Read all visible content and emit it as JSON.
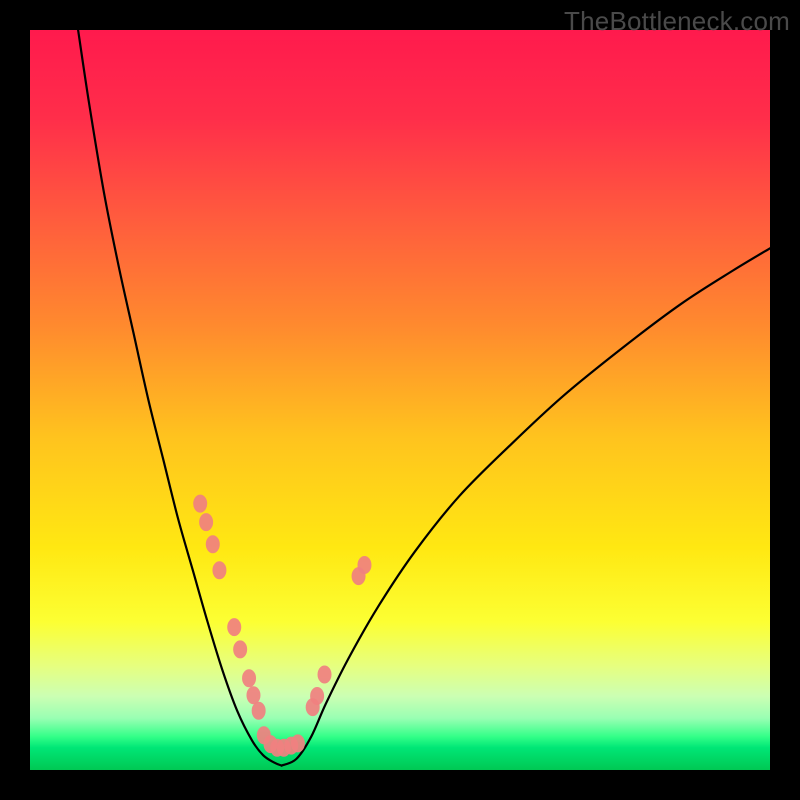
{
  "watermark": "TheBottleneck.com",
  "chart_data": {
    "type": "line",
    "title": "",
    "xlabel": "",
    "ylabel": "",
    "xlim": [
      0,
      100
    ],
    "ylim": [
      0,
      100
    ],
    "background_gradient": {
      "stops": [
        {
          "offset": 0,
          "color": "#ff1a4d"
        },
        {
          "offset": 0.12,
          "color": "#ff2e4a"
        },
        {
          "offset": 0.25,
          "color": "#ff5a3e"
        },
        {
          "offset": 0.4,
          "color": "#ff8a2e"
        },
        {
          "offset": 0.55,
          "color": "#ffc31e"
        },
        {
          "offset": 0.7,
          "color": "#ffe812"
        },
        {
          "offset": 0.8,
          "color": "#fcff33"
        },
        {
          "offset": 0.86,
          "color": "#e6ff80"
        },
        {
          "offset": 0.9,
          "color": "#ccffb3"
        },
        {
          "offset": 0.93,
          "color": "#99ffb3"
        },
        {
          "offset": 0.955,
          "color": "#33ff88"
        },
        {
          "offset": 0.97,
          "color": "#00e676"
        },
        {
          "offset": 1.0,
          "color": "#00c853"
        }
      ]
    },
    "series": [
      {
        "name": "left-curve",
        "stroke": "#000000",
        "values_xy": [
          [
            6.5,
            100.0
          ],
          [
            8.0,
            90.0
          ],
          [
            10.0,
            78.0
          ],
          [
            12.0,
            68.0
          ],
          [
            14.0,
            59.0
          ],
          [
            16.0,
            50.0
          ],
          [
            18.0,
            42.0
          ],
          [
            20.0,
            34.0
          ],
          [
            22.0,
            27.0
          ],
          [
            24.0,
            20.0
          ],
          [
            26.0,
            13.5
          ],
          [
            28.0,
            8.0
          ],
          [
            30.0,
            4.0
          ],
          [
            31.5,
            2.0
          ],
          [
            33.0,
            1.0
          ],
          [
            34.0,
            0.6
          ]
        ]
      },
      {
        "name": "right-curve",
        "stroke": "#000000",
        "values_xy": [
          [
            34.0,
            0.6
          ],
          [
            36.0,
            1.5
          ],
          [
            38.0,
            4.5
          ],
          [
            40.0,
            9.0
          ],
          [
            43.0,
            15.0
          ],
          [
            47.0,
            22.0
          ],
          [
            52.0,
            29.5
          ],
          [
            58.0,
            37.0
          ],
          [
            65.0,
            44.0
          ],
          [
            72.0,
            50.5
          ],
          [
            80.0,
            57.0
          ],
          [
            88.0,
            63.0
          ],
          [
            95.0,
            67.5
          ],
          [
            100.0,
            70.5
          ]
        ]
      }
    ],
    "markers": {
      "color": "#f08080",
      "points_xy": [
        [
          23.0,
          36.0
        ],
        [
          23.8,
          33.5
        ],
        [
          24.7,
          30.5
        ],
        [
          25.6,
          27.0
        ],
        [
          27.6,
          19.3
        ],
        [
          28.4,
          16.3
        ],
        [
          29.6,
          12.4
        ],
        [
          30.2,
          10.1
        ],
        [
          30.9,
          8.0
        ],
        [
          31.6,
          4.7
        ],
        [
          32.5,
          3.5
        ],
        [
          33.4,
          3.0
        ],
        [
          34.3,
          3.0
        ],
        [
          35.3,
          3.3
        ],
        [
          36.2,
          3.6
        ],
        [
          38.2,
          8.5
        ],
        [
          38.8,
          10.0
        ],
        [
          39.8,
          12.9
        ],
        [
          44.4,
          26.2
        ],
        [
          45.2,
          27.7
        ]
      ]
    }
  }
}
